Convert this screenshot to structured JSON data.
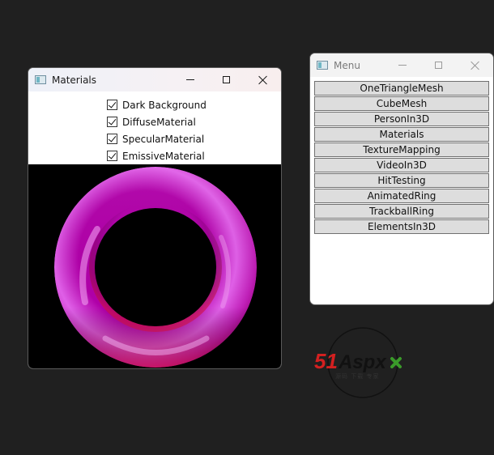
{
  "materials_window": {
    "title": "Materials",
    "checkboxes": [
      {
        "label": "Dark Background",
        "checked": true
      },
      {
        "label": "DiffuseMaterial",
        "checked": true
      },
      {
        "label": "SpecularMaterial",
        "checked": true
      },
      {
        "label": "EmissiveMaterial",
        "checked": true
      }
    ],
    "viewport_background": "#000000",
    "torus_color": "#c020c0"
  },
  "menu_window": {
    "title": "Menu",
    "items": [
      "OneTriangleMesh",
      "CubeMesh",
      "PersonIn3D",
      "Materials",
      "TextureMapping",
      "VideoIn3D",
      "HitTesting",
      "AnimatedRing",
      "TrackballRing",
      "ElementsIn3D"
    ]
  },
  "watermark": {
    "text": "51Aspx",
    "subtext": "源码 下载 专家",
    "colors": {
      "red": "#d42020",
      "green": "#3a9a2a"
    }
  }
}
